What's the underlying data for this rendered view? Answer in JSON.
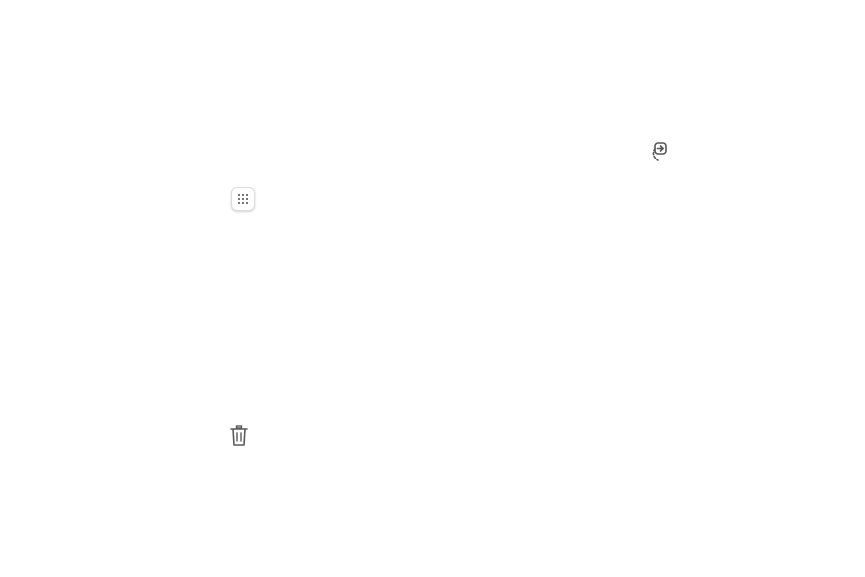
{
  "screen": {
    "background": "#ffffff"
  },
  "icons": {
    "import": {
      "name": "import-arrow-icon",
      "color": "#555555"
    },
    "apps": {
      "name": "apps-grid-icon",
      "color": "#4a4a4a"
    },
    "trash": {
      "name": "trash-can-icon",
      "color": "#5a5a5a"
    }
  }
}
